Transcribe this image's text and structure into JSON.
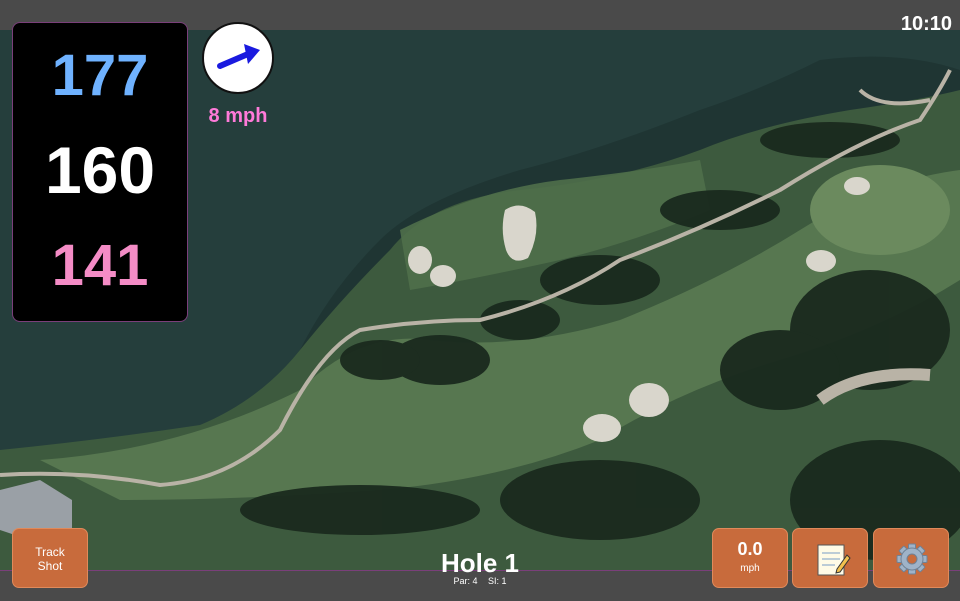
{
  "status": {
    "time": "10:10"
  },
  "distances": {
    "back": "177",
    "middle": "160",
    "front": "141"
  },
  "wind": {
    "speed_label": "8 mph",
    "direction_icon": "wind-arrow-icon"
  },
  "hole": {
    "title": "Hole 1",
    "par": "Par: 4",
    "stroke_index": "SI: 1"
  },
  "buttons": {
    "track_shot": [
      "Track",
      "Shot"
    ],
    "speed_value": "0.0",
    "speed_unit": "mph",
    "notes_icon": "notepad-icon",
    "settings_icon": "gear-icon"
  },
  "colors": {
    "back": "#6fb2ff",
    "middle": "#ffffff",
    "front": "#f48cc6",
    "wind_text": "#ff7ad9",
    "button": "#c86b3c"
  }
}
